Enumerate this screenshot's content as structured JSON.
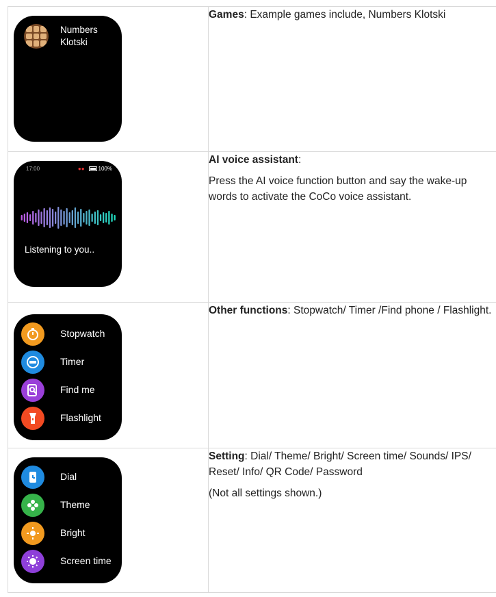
{
  "rows": [
    {
      "watch": {
        "items": [
          "Numbers",
          "Klotski"
        ]
      },
      "heading": "Games",
      "body": ": Example games include, Numbers Klotski"
    },
    {
      "watch": {
        "time": "17:00",
        "battery": "100%",
        "listening": "Listening to you.."
      },
      "heading": "AI voice assistant",
      "heading_suffix": ":",
      "body": "Press the AI voice function button and say the wake-up words to activate the CoCo voice assistant."
    },
    {
      "watch": {
        "items": [
          {
            "label": "Stopwatch",
            "icon": "stopwatch-icon",
            "color": "#f29a1f"
          },
          {
            "label": "Timer",
            "icon": "timer-icon",
            "color": "#1f8be0"
          },
          {
            "label": "Find me",
            "icon": "find-icon",
            "color": "#9a3fd9"
          },
          {
            "label": "Flashlight",
            "icon": "flashlight-icon",
            "color": "#f24a22"
          }
        ]
      },
      "heading": "Other functions",
      "body": ": Stopwatch/ Timer /Find phone / Flashlight."
    },
    {
      "watch": {
        "items": [
          {
            "label": "Dial",
            "icon": "dial-icon",
            "color": "#1f8be0"
          },
          {
            "label": "Theme",
            "icon": "theme-icon",
            "color": "#36b34a"
          },
          {
            "label": "Bright",
            "icon": "bright-icon",
            "color": "#f29a1f"
          },
          {
            "label": "Screen time",
            "icon": "screen-time-icon",
            "color": "#8e3fd9"
          }
        ]
      },
      "heading": "Setting",
      "body": ": Dial/ Theme/ Bright/ Screen time/ Sounds/ IPS/ Reset/ Info/ QR Code/ Password",
      "note": "(Not all settings shown.)"
    }
  ]
}
